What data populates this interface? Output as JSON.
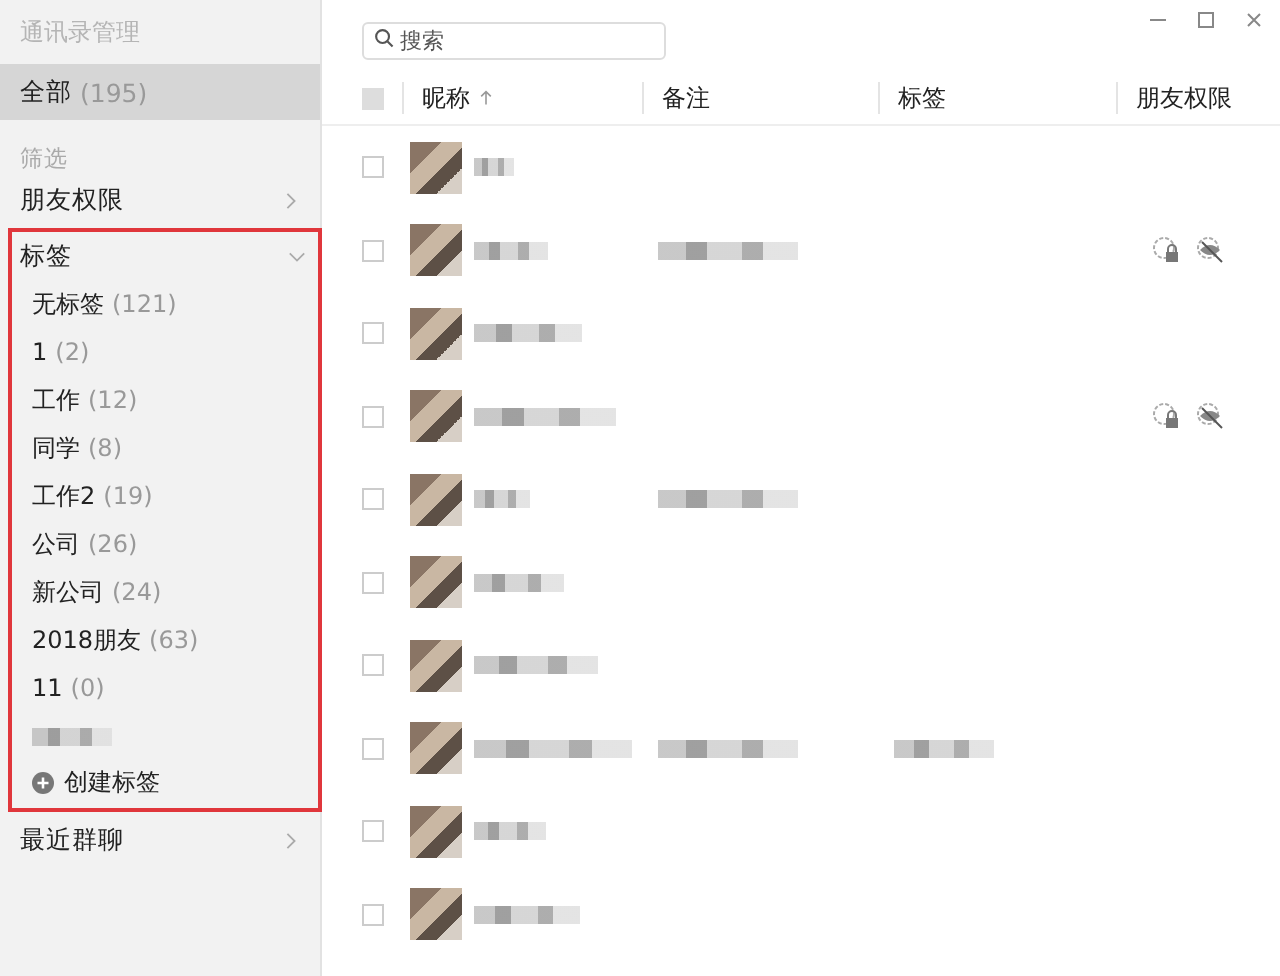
{
  "window": {
    "title": "通讯录管理"
  },
  "search": {
    "placeholder": "搜索"
  },
  "sidebar": {
    "all": {
      "label": "全部",
      "count": "(195)",
      "selected": true
    },
    "filter_heading": "筛选",
    "friend_permissions": {
      "label": "朋友权限",
      "expanded": false
    },
    "tags": {
      "label": "标签",
      "expanded": true,
      "highlighted": true,
      "items": [
        {
          "kind": "tag",
          "label": "无标签",
          "count": "(121)"
        },
        {
          "kind": "tag",
          "label": "1",
          "count": "(2)"
        },
        {
          "kind": "tag",
          "label": "工作",
          "count": "(12)"
        },
        {
          "kind": "tag",
          "label": "同学",
          "count": "(8)"
        },
        {
          "kind": "tag",
          "label": "工作2",
          "count": "(19)"
        },
        {
          "kind": "tag",
          "label": "公司",
          "count": "(26)"
        },
        {
          "kind": "tag",
          "label": "新公司",
          "count": "(24)"
        },
        {
          "kind": "tag",
          "label": "2018朋友",
          "count": "(63)"
        },
        {
          "kind": "tag",
          "label": "11",
          "count": "(0)"
        },
        {
          "kind": "blurred"
        }
      ],
      "create_label": "创建标签"
    },
    "recent_groups": {
      "label": "最近群聊",
      "expanded": false
    }
  },
  "table": {
    "select_all_checked": false,
    "columns": [
      {
        "label": "昵称",
        "sorted": true
      },
      {
        "label": "备注",
        "sorted": false
      },
      {
        "label": "标签",
        "sorted": false
      },
      {
        "label": "朋友权限",
        "sorted": false
      }
    ],
    "rows": [
      {
        "checked": false,
        "note": false,
        "tag": false,
        "permissions": false
      },
      {
        "checked": false,
        "note": true,
        "tag": false,
        "permissions": true
      },
      {
        "checked": false,
        "note": false,
        "tag": false,
        "permissions": false
      },
      {
        "checked": false,
        "note": false,
        "tag": false,
        "permissions": true
      },
      {
        "checked": false,
        "note": true,
        "tag": false,
        "permissions": false
      },
      {
        "checked": false,
        "note": false,
        "tag": false,
        "permissions": false
      },
      {
        "checked": false,
        "note": false,
        "tag": false,
        "permissions": false
      },
      {
        "checked": false,
        "note": true,
        "tag": true,
        "permissions": false
      },
      {
        "checked": false,
        "note": false,
        "tag": false,
        "permissions": false
      },
      {
        "checked": false,
        "note": false,
        "tag": false,
        "permissions": false
      }
    ]
  }
}
